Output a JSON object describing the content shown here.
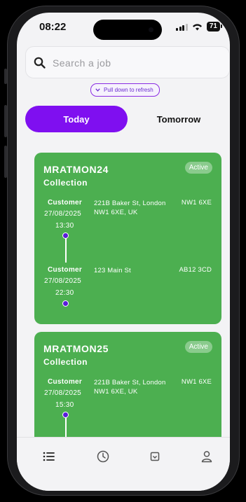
{
  "status_bar": {
    "time": "08:22",
    "battery": "71"
  },
  "search": {
    "placeholder": "Search a job",
    "value": ""
  },
  "refresh_hint": {
    "label": "Pull down to refresh"
  },
  "day_tabs": {
    "today": "Today",
    "tomorrow": "Tomorrow",
    "selected": "Today"
  },
  "colors": {
    "accent": "#7f0ff0",
    "card": "#4caf50",
    "badge": "#7cc47f",
    "dot": "#5a1dd8"
  },
  "jobs": [
    {
      "id": "MRATMON24",
      "type": "Collection",
      "status": "Active",
      "stops": [
        {
          "role": "Customer",
          "date": "27/08/2025",
          "time": "13:30",
          "address": "221B Baker St, London NW1 6XE, UK",
          "postcode": "NW1 6XE"
        },
        {
          "role": "Customer",
          "date": "27/08/2025",
          "time": "22:30",
          "address": "123 Main St",
          "postcode": "AB12 3CD"
        }
      ]
    },
    {
      "id": "MRATMON25",
      "type": "Collection",
      "status": "Active",
      "stops": [
        {
          "role": "Customer",
          "date": "27/08/2025",
          "time": "15:30",
          "address": "221B Baker St, London NW1 6XE, UK",
          "postcode": "NW1 6XE"
        }
      ]
    }
  ],
  "bottom_nav": [
    {
      "name": "jobs-list",
      "icon": "list-icon",
      "active": true
    },
    {
      "name": "history",
      "icon": "clock-icon",
      "active": false
    },
    {
      "name": "inbox",
      "icon": "tray-icon",
      "active": false
    },
    {
      "name": "profile",
      "icon": "person-icon",
      "active": false
    }
  ]
}
